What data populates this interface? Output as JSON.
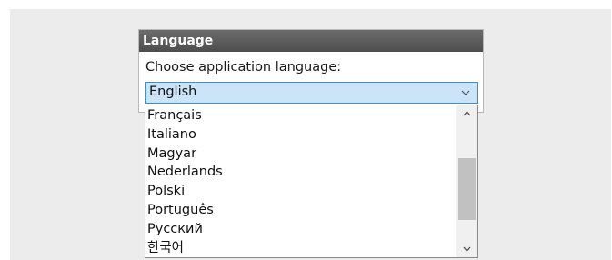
{
  "dialog": {
    "title": "Language",
    "prompt": "Choose application language:"
  },
  "language_select": {
    "selected": "English",
    "arrow_icon": "chevron-down-icon"
  },
  "language_list": {
    "items": [
      "Français",
      "Italiano",
      "Magyar",
      "Nederlands",
      "Polski",
      "Português",
      "Русский",
      "한국어"
    ],
    "scroll_up_icon": "chevron-up-icon",
    "scroll_down_icon": "chevron-down-icon"
  },
  "colors": {
    "title_bar": "#555555",
    "selection_fill": "#cce4f7",
    "selection_border": "#3c8fd3",
    "scroll_thumb": "#c1c1c1"
  }
}
